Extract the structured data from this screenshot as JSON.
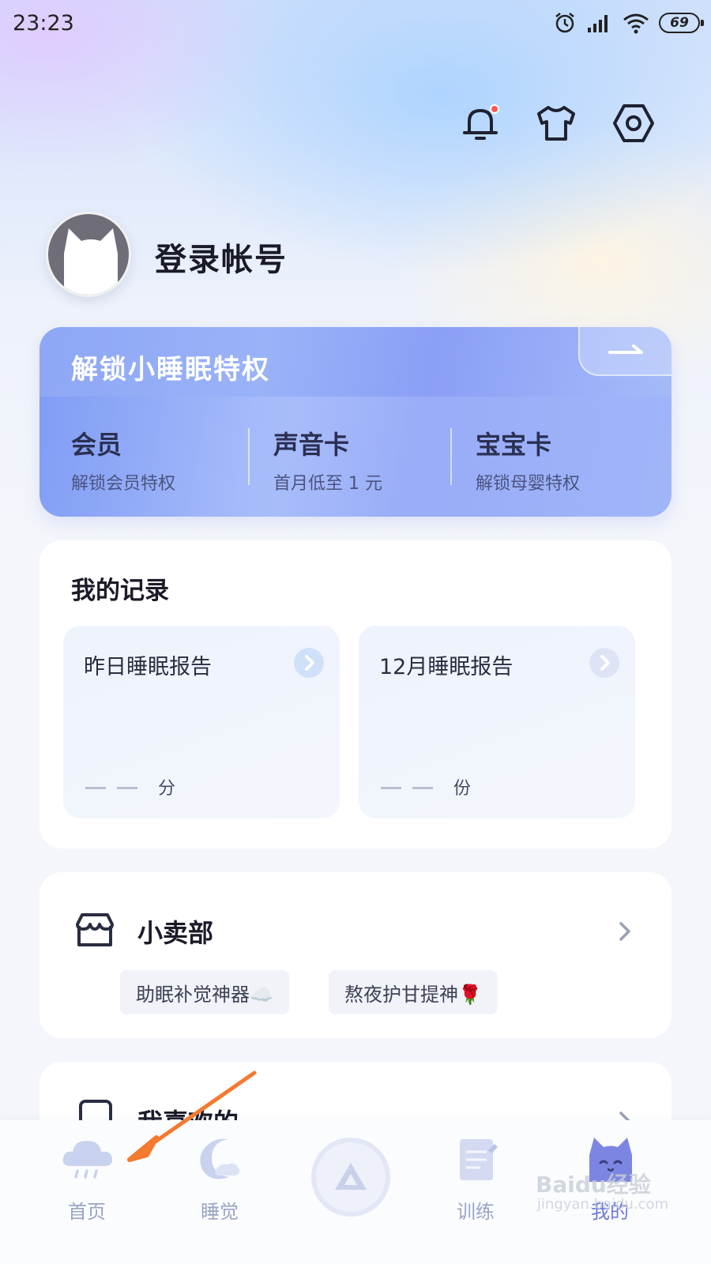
{
  "status_bar": {
    "time": "23:23",
    "battery": "69"
  },
  "profile": {
    "login_label": "登录帐号"
  },
  "vip": {
    "title": "解锁小睡眠特权",
    "items": [
      {
        "title": "会员",
        "subtitle": "解锁会员特权"
      },
      {
        "title": "声音卡",
        "subtitle": "首月低至 1 元"
      },
      {
        "title": "宝宝卡",
        "subtitle": "解锁母婴特权"
      }
    ]
  },
  "records": {
    "title": "我的记录",
    "reports": [
      {
        "title": "昨日睡眠报告",
        "unit": "分"
      },
      {
        "title": "12月睡眠报告",
        "unit": "份"
      }
    ]
  },
  "shop": {
    "title": "小卖部",
    "tags": [
      "助眠补觉神器☁️",
      "熬夜护甘提神🌹"
    ]
  },
  "favorites": {
    "title": "我喜欢的"
  },
  "nav": [
    {
      "label": "首页",
      "active": false
    },
    {
      "label": "睡觉",
      "active": false
    },
    {
      "label": "训练",
      "active": false
    },
    {
      "label": "我的",
      "active": true
    }
  ],
  "watermark": {
    "brand": "Baidu经验",
    "url": "jingyan.baidu.com"
  },
  "colors": {
    "accent": "#6c79d6",
    "vip_card": "#8ea7f5",
    "annotation_arrow": "#f47a30",
    "notification_dot": "#ff5a4f"
  }
}
